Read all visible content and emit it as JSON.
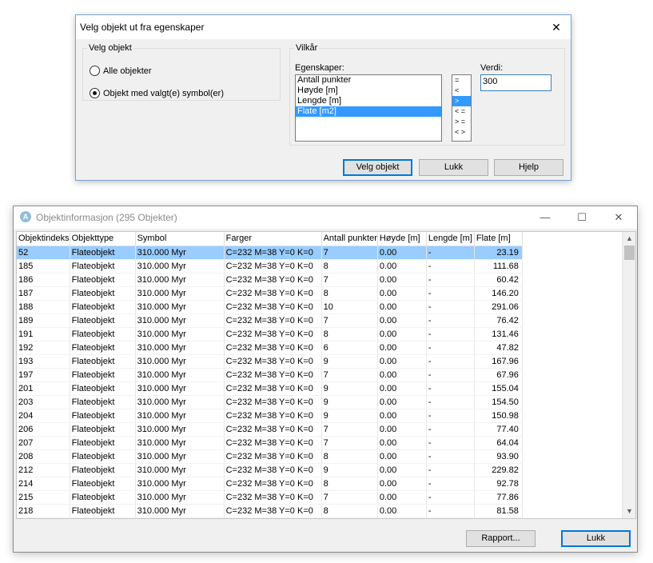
{
  "select_dialog": {
    "title": "Velg objekt ut fra egenskaper",
    "close_glyph": "✕",
    "group_select": {
      "legend": "Velg objekt",
      "options": [
        {
          "label": "Alle objekter",
          "checked": false
        },
        {
          "label": "Objekt med valgt(e) symbol(er)",
          "checked": true
        }
      ]
    },
    "group_condition": {
      "legend": "Vilkår",
      "properties_label": "Egenskaper:",
      "properties": [
        "Antall punkter",
        "Høyde [m]",
        "Lengde [m]",
        "Flate [m2]"
      ],
      "selected_property": "Flate [m2]",
      "operators": [
        "=",
        "<",
        ">",
        "< =",
        "> =",
        "< >"
      ],
      "selected_operator": ">",
      "value_label": "Verdi:",
      "value": "300"
    },
    "buttons": {
      "select": "Velg objekt",
      "close": "Lukk",
      "help": "Hjelp"
    }
  },
  "info_window": {
    "app_icon_letter": "A",
    "title": "Objektinformasjon (295 Objekter)",
    "controls": {
      "minimize": "—",
      "maximize": "☐",
      "close": "✕"
    },
    "columns": [
      "Objektindeks",
      "Objekttype",
      "Symbol",
      "Farger",
      "Antall punkter",
      "Høyde [m]",
      "Lengde [m]",
      "Flate [m]"
    ],
    "selected_row_index": 0,
    "rows": [
      [
        "52",
        "Flateobjekt",
        "310.000 Myr",
        "C=232 M=38 Y=0 K=0",
        "7",
        "0.00",
        "-",
        "23.19"
      ],
      [
        "185",
        "Flateobjekt",
        "310.000 Myr",
        "C=232 M=38 Y=0 K=0",
        "8",
        "0.00",
        "-",
        "111.68"
      ],
      [
        "186",
        "Flateobjekt",
        "310.000 Myr",
        "C=232 M=38 Y=0 K=0",
        "7",
        "0.00",
        "-",
        "60.42"
      ],
      [
        "187",
        "Flateobjekt",
        "310.000 Myr",
        "C=232 M=38 Y=0 K=0",
        "8",
        "0.00",
        "-",
        "146.20"
      ],
      [
        "188",
        "Flateobjekt",
        "310.000 Myr",
        "C=232 M=38 Y=0 K=0",
        "10",
        "0.00",
        "-",
        "291.06"
      ],
      [
        "189",
        "Flateobjekt",
        "310.000 Myr",
        "C=232 M=38 Y=0 K=0",
        "7",
        "0.00",
        "-",
        "76.42"
      ],
      [
        "191",
        "Flateobjekt",
        "310.000 Myr",
        "C=232 M=38 Y=0 K=0",
        "8",
        "0.00",
        "-",
        "131.46"
      ],
      [
        "192",
        "Flateobjekt",
        "310.000 Myr",
        "C=232 M=38 Y=0 K=0",
        "6",
        "0.00",
        "-",
        "47.82"
      ],
      [
        "193",
        "Flateobjekt",
        "310.000 Myr",
        "C=232 M=38 Y=0 K=0",
        "9",
        "0.00",
        "-",
        "167.96"
      ],
      [
        "197",
        "Flateobjekt",
        "310.000 Myr",
        "C=232 M=38 Y=0 K=0",
        "7",
        "0.00",
        "-",
        "67.96"
      ],
      [
        "201",
        "Flateobjekt",
        "310.000 Myr",
        "C=232 M=38 Y=0 K=0",
        "9",
        "0.00",
        "-",
        "155.04"
      ],
      [
        "203",
        "Flateobjekt",
        "310.000 Myr",
        "C=232 M=38 Y=0 K=0",
        "9",
        "0.00",
        "-",
        "154.50"
      ],
      [
        "204",
        "Flateobjekt",
        "310.000 Myr",
        "C=232 M=38 Y=0 K=0",
        "9",
        "0.00",
        "-",
        "150.98"
      ],
      [
        "206",
        "Flateobjekt",
        "310.000 Myr",
        "C=232 M=38 Y=0 K=0",
        "7",
        "0.00",
        "-",
        "77.40"
      ],
      [
        "207",
        "Flateobjekt",
        "310.000 Myr",
        "C=232 M=38 Y=0 K=0",
        "7",
        "0.00",
        "-",
        "64.04"
      ],
      [
        "208",
        "Flateobjekt",
        "310.000 Myr",
        "C=232 M=38 Y=0 K=0",
        "8",
        "0.00",
        "-",
        "93.90"
      ],
      [
        "212",
        "Flateobjekt",
        "310.000 Myr",
        "C=232 M=38 Y=0 K=0",
        "9",
        "0.00",
        "-",
        "229.82"
      ],
      [
        "214",
        "Flateobjekt",
        "310.000 Myr",
        "C=232 M=38 Y=0 K=0",
        "8",
        "0.00",
        "-",
        "92.78"
      ],
      [
        "215",
        "Flateobjekt",
        "310.000 Myr",
        "C=232 M=38 Y=0 K=0",
        "7",
        "0.00",
        "-",
        "77.86"
      ],
      [
        "218",
        "Flateobjekt",
        "310.000 Myr",
        "C=232 M=38 Y=0 K=0",
        "8",
        "0.00",
        "-",
        "81.58"
      ]
    ],
    "scroll_up_glyph": "▲",
    "scroll_down_glyph": "▼",
    "buttons": {
      "report": "Rapport...",
      "close": "Lukk"
    }
  }
}
